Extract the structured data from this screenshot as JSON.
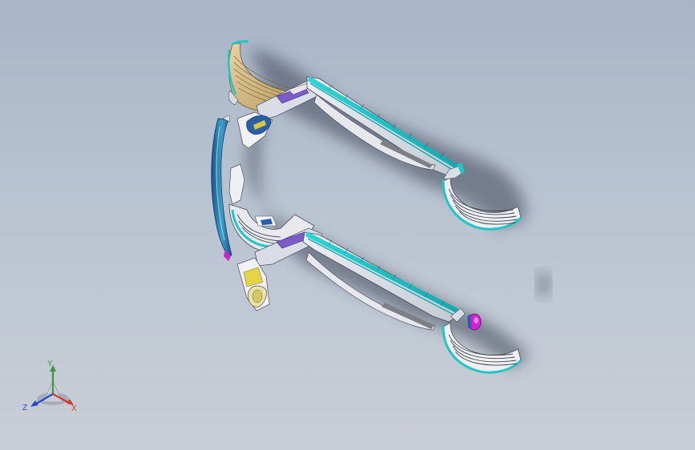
{
  "viewport": {
    "background_top": "#a7b5c7",
    "background_bottom": "#c9ced6"
  },
  "triad": {
    "x_label": "X",
    "y_label": "Y",
    "z_label": "Z",
    "x_color": "#d33a2a",
    "y_color": "#3a9a3a",
    "z_color": "#2a49c9"
  },
  "model": {
    "accent_cyan": "#1fc7c9",
    "accent_tan": "#c9b07a",
    "accent_blue": "#2a5fa8",
    "accent_magenta": "#d21fd2",
    "accent_yellow": "#e6d447"
  }
}
